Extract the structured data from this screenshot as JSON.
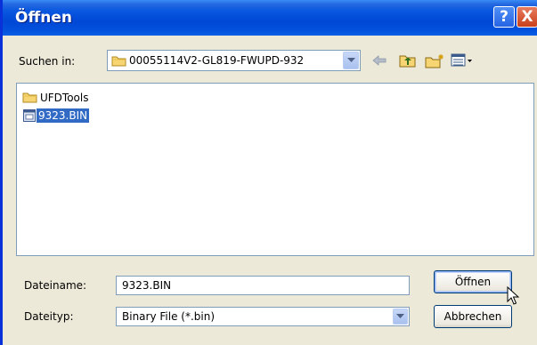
{
  "window": {
    "title": "Öffnen",
    "help_glyph": "?",
    "close_glyph": "X"
  },
  "lookin": {
    "label": "Suchen in:",
    "value": "00055114V2-GL819-FWUPD-932",
    "icon": "folder-icon"
  },
  "toolbar": {
    "icons": [
      "back-arrow-icon",
      "up-folder-icon",
      "new-folder-icon",
      "view-menu-icon"
    ]
  },
  "files": [
    {
      "name": "UFDTools",
      "type": "folder",
      "icon": "folder-icon",
      "selected": false
    },
    {
      "name": "9323.BIN",
      "type": "file",
      "icon": "bin-file-icon",
      "selected": true
    }
  ],
  "filename": {
    "label": "Dateiname:",
    "value": "9323.BIN"
  },
  "filetype": {
    "label": "Dateityp:",
    "value": "Binary File (*.bin)"
  },
  "buttons": {
    "open": "Öffnen",
    "cancel": "Abbrechen"
  },
  "colors": {
    "titlebar": "#0a58e0",
    "selection": "#316ac5",
    "dialog_bg": "#ece9d8"
  }
}
